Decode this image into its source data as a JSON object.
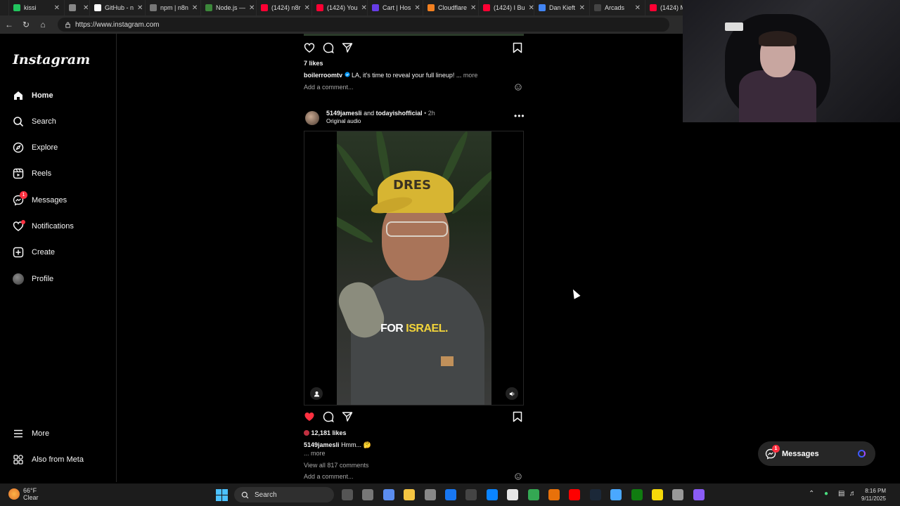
{
  "browser": {
    "tabs": [
      {
        "label": "kissi",
        "color": "#22c55e"
      },
      {
        "label": "",
        "color": "#888888"
      },
      {
        "label": "GitHub - n",
        "color": "#ffffff"
      },
      {
        "label": "npm | n8n",
        "color": "#777777"
      },
      {
        "label": "Node.js —",
        "color": "#3c873a"
      },
      {
        "label": "(1424) n8r",
        "color": "#ff0033"
      },
      {
        "label": "(1424) You",
        "color": "#ff0033"
      },
      {
        "label": "Cart | Hos",
        "color": "#673de6"
      },
      {
        "label": "Cloudflare",
        "color": "#f38020"
      },
      {
        "label": "(1424) I Bu",
        "color": "#ff0033"
      },
      {
        "label": "Dan Kieft",
        "color": "#4285f4"
      },
      {
        "label": "Arcads",
        "color": "#444444"
      },
      {
        "label": "(1424) Ma",
        "color": "#ff0033"
      }
    ],
    "url": "https://www.instagram.com"
  },
  "sidebar": {
    "logo": "Instagram",
    "items": [
      {
        "label": "Home",
        "icon": "home-icon"
      },
      {
        "label": "Search",
        "icon": "search-icon"
      },
      {
        "label": "Explore",
        "icon": "compass-icon"
      },
      {
        "label": "Reels",
        "icon": "reels-icon"
      },
      {
        "label": "Messages",
        "icon": "messenger-icon",
        "badge": "1"
      },
      {
        "label": "Notifications",
        "icon": "heart-icon"
      },
      {
        "label": "Create",
        "icon": "plus-square-icon"
      },
      {
        "label": "Profile",
        "icon": "avatar"
      }
    ],
    "more": "More",
    "also_meta": "Also from Meta"
  },
  "post1": {
    "likes": "7 likes",
    "username": "boilerroomtv",
    "caption": "LA, it's time to reveal your full lineup! ...",
    "more": "more",
    "add_comment": "Add a comment..."
  },
  "post2": {
    "user1": "5149jamesli",
    "and": "and",
    "user2": "todayishofficial",
    "time": "• 2h",
    "audio": "Original audio",
    "video_caption_white": "FOR",
    "video_caption_yellow": "ISRAEL.",
    "hat_text": "DRES",
    "likes": "12,181 likes",
    "username": "5149jamesli",
    "caption": "Hmm... 🤔",
    "more_prefix": "...",
    "more": "more",
    "view_comments": "View all 817 comments",
    "add_comment": "Add a comment..."
  },
  "messages_pill": {
    "label": "Messages",
    "badge": "1"
  },
  "taskbar": {
    "temp": "66°F",
    "condition": "Clear",
    "search": "Search",
    "time": "8:16 PM",
    "date": "9/11/2025"
  },
  "colors": {
    "like_red": "#ff3040",
    "verified_blue": "#0095f6",
    "caption_yellow": "#f2d43a"
  }
}
